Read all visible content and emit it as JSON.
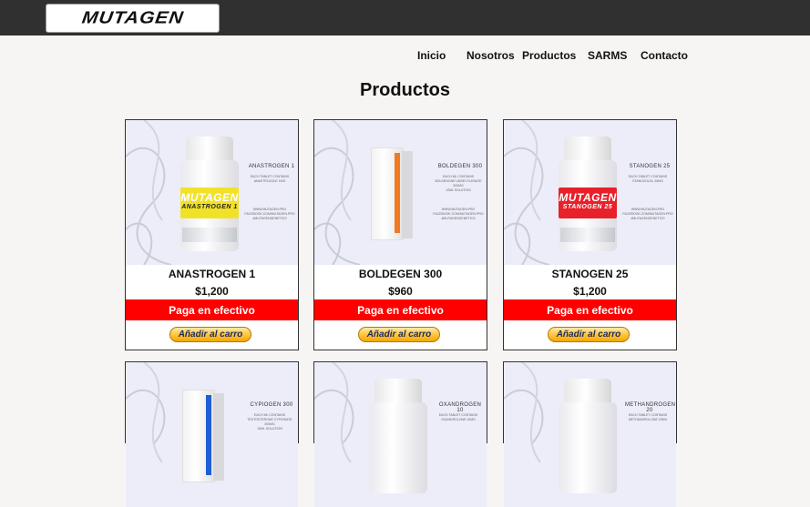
{
  "header": {
    "logo_text": "MUTAGEN"
  },
  "nav": {
    "items": [
      "Inicio",
      "Nosotros",
      "Productos",
      "SARMS",
      "Contacto"
    ]
  },
  "page": {
    "title": "Productos"
  },
  "colors": {
    "accent_red": "#ff0000",
    "topbar": "#303030",
    "button_gold": "#ffc23a"
  },
  "products": [
    {
      "name": "ANASTROGEN 1",
      "price": "$1,200",
      "payment_label": "Paga en efectivo",
      "cart_label": "Añadir al carro",
      "image": {
        "label": "ANASTROGEN 1",
        "band_text": "MUTAGEN",
        "band_sub": "ANASTROGEN 1",
        "band_color": "#f2e227",
        "lines": [
          "EACH TABLET CONTAINS",
          "ANASTROZOLE 1MG"
        ],
        "links": [
          "WWW.MUTAGEN.PRO",
          "FACEBOOK.COM/MUTAGEN.PRO",
          "#MUTAGENGENETICS"
        ]
      }
    },
    {
      "name": "BOLDEGEN 300",
      "price": "$960",
      "payment_label": "Paga en efectivo",
      "cart_label": "Añadir al carro",
      "image": {
        "label": "BOLDEGEN 300",
        "band_text": "BOLDEGEN 300",
        "band_color": "#f07a1f",
        "lines": [
          "EACH ML CONTAINS",
          "BOLDENONE UNDECYLENATE 300MG",
          "10ML SOLUTION"
        ],
        "links": [
          "WWW.MUTAGEN.PRO",
          "FACEBOOK.COM/MUTAGEN.PRO",
          "#MUTAGENGENETICS"
        ]
      }
    },
    {
      "name": "STANOGEN 25",
      "price": "$1,200",
      "payment_label": "Paga en efectivo",
      "cart_label": "Añadir al carro",
      "image": {
        "label": "STANOGEN 25",
        "band_text": "MUTAGEN",
        "band_sub": "STANOGEN 25",
        "band_color": "#e8202a",
        "lines": [
          "EACH TABLET CONTAINS",
          "STANOZOLOL 25MG"
        ],
        "links": [
          "WWW.MUTAGEN.PRO",
          "FACEBOOK.COM/MUTAGEN.PRO",
          "#MUTAGENGENETICS"
        ]
      }
    },
    {
      "name": "",
      "price": "",
      "image": {
        "label": "CYPIOGEN 300",
        "band_color": "#1f5fd6",
        "lines": [
          "EACH ML CONTAINS",
          "TESTOSTERONE CYPIONATE 300MG",
          "10ML SOLUTION"
        ]
      }
    },
    {
      "name": "",
      "price": "",
      "image": {
        "label": "OXANDROGEN 10",
        "lines": [
          "EACH TABLET CONTAINS",
          "OXANDROLONE 10MG"
        ]
      }
    },
    {
      "name": "",
      "price": "",
      "image": {
        "label": "METHANDROGEN 20",
        "lines": [
          "EACH TABLET CONTAINS",
          "METHANDROLONE 20MG"
        ]
      }
    }
  ]
}
